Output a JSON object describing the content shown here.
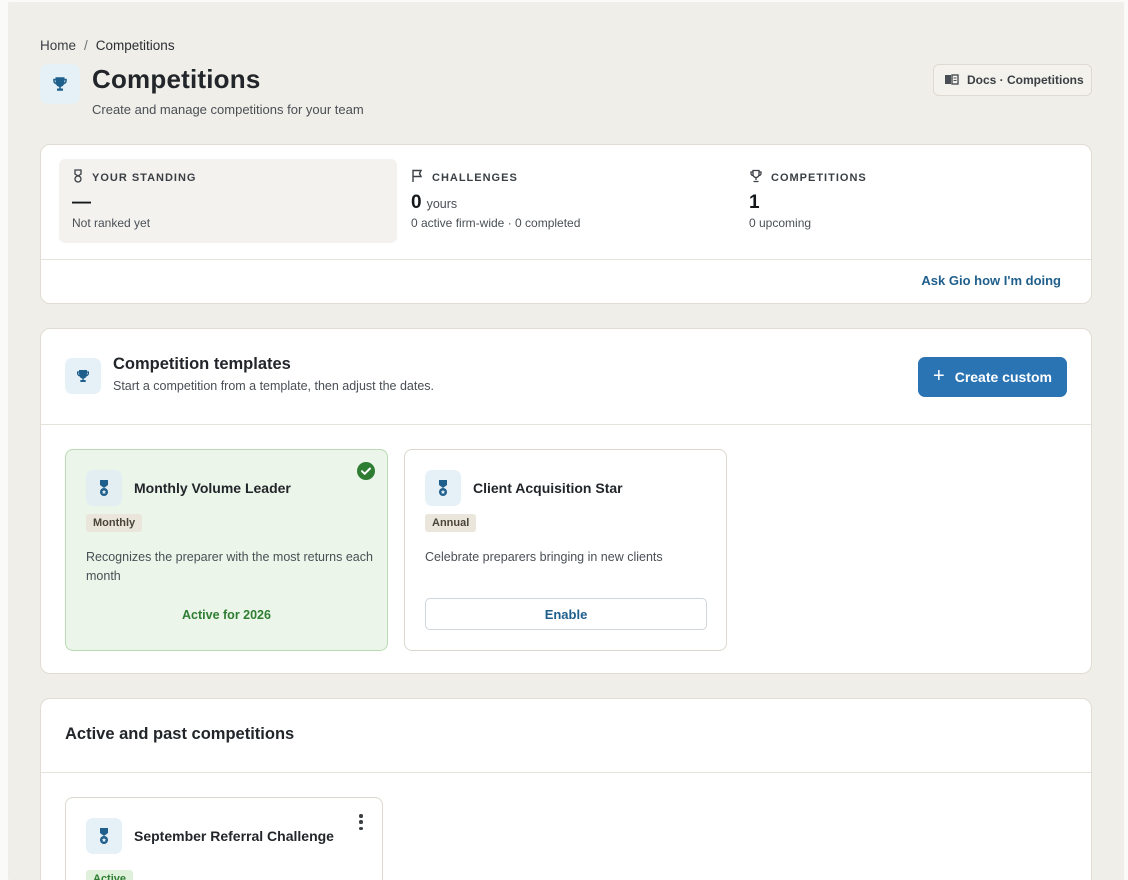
{
  "breadcrumb": {
    "home": "Home",
    "separator": "/",
    "current": "Competitions"
  },
  "header": {
    "title": "Competitions",
    "subtitle": "Create and manage competitions for your team",
    "icon": "trophy-icon",
    "docs_button": "Docs · Competitions"
  },
  "stats": {
    "standing": {
      "label": "YOUR STANDING",
      "value": "—",
      "sub": "Not ranked yet",
      "icon": "medal-icon"
    },
    "challenges": {
      "label": "CHALLENGES",
      "value": "0",
      "unit": "yours",
      "sub": "0 active firm-wide · 0 completed",
      "icon": "flag-icon"
    },
    "competitions": {
      "label": "COMPETITIONS",
      "value": "1",
      "sub": "0 upcoming",
      "icon": "trophy-icon"
    },
    "ask_link": "Ask Gio how I'm doing"
  },
  "templates": {
    "title": "Competition templates",
    "subtitle": "Start a competition from a template, then adjust the dates.",
    "create_button": "Create custom",
    "items": [
      {
        "name": "Monthly Volume Leader",
        "badge": "Monthly",
        "description": "Recognizes the preparer with the most returns each month",
        "status": "Active for 2026"
      },
      {
        "name": "Client Acquisition Star",
        "badge": "Annual",
        "description": "Celebrate preparers bringing in new clients",
        "action": "Enable"
      }
    ]
  },
  "past": {
    "title": "Active and past competitions",
    "items": [
      {
        "name": "September Referral Challenge",
        "badge": "Active"
      }
    ]
  },
  "colors": {
    "accent": "#2a74b3",
    "link": "#1f5f8c",
    "success": "#2e7d32",
    "background": "#f0eee8"
  }
}
